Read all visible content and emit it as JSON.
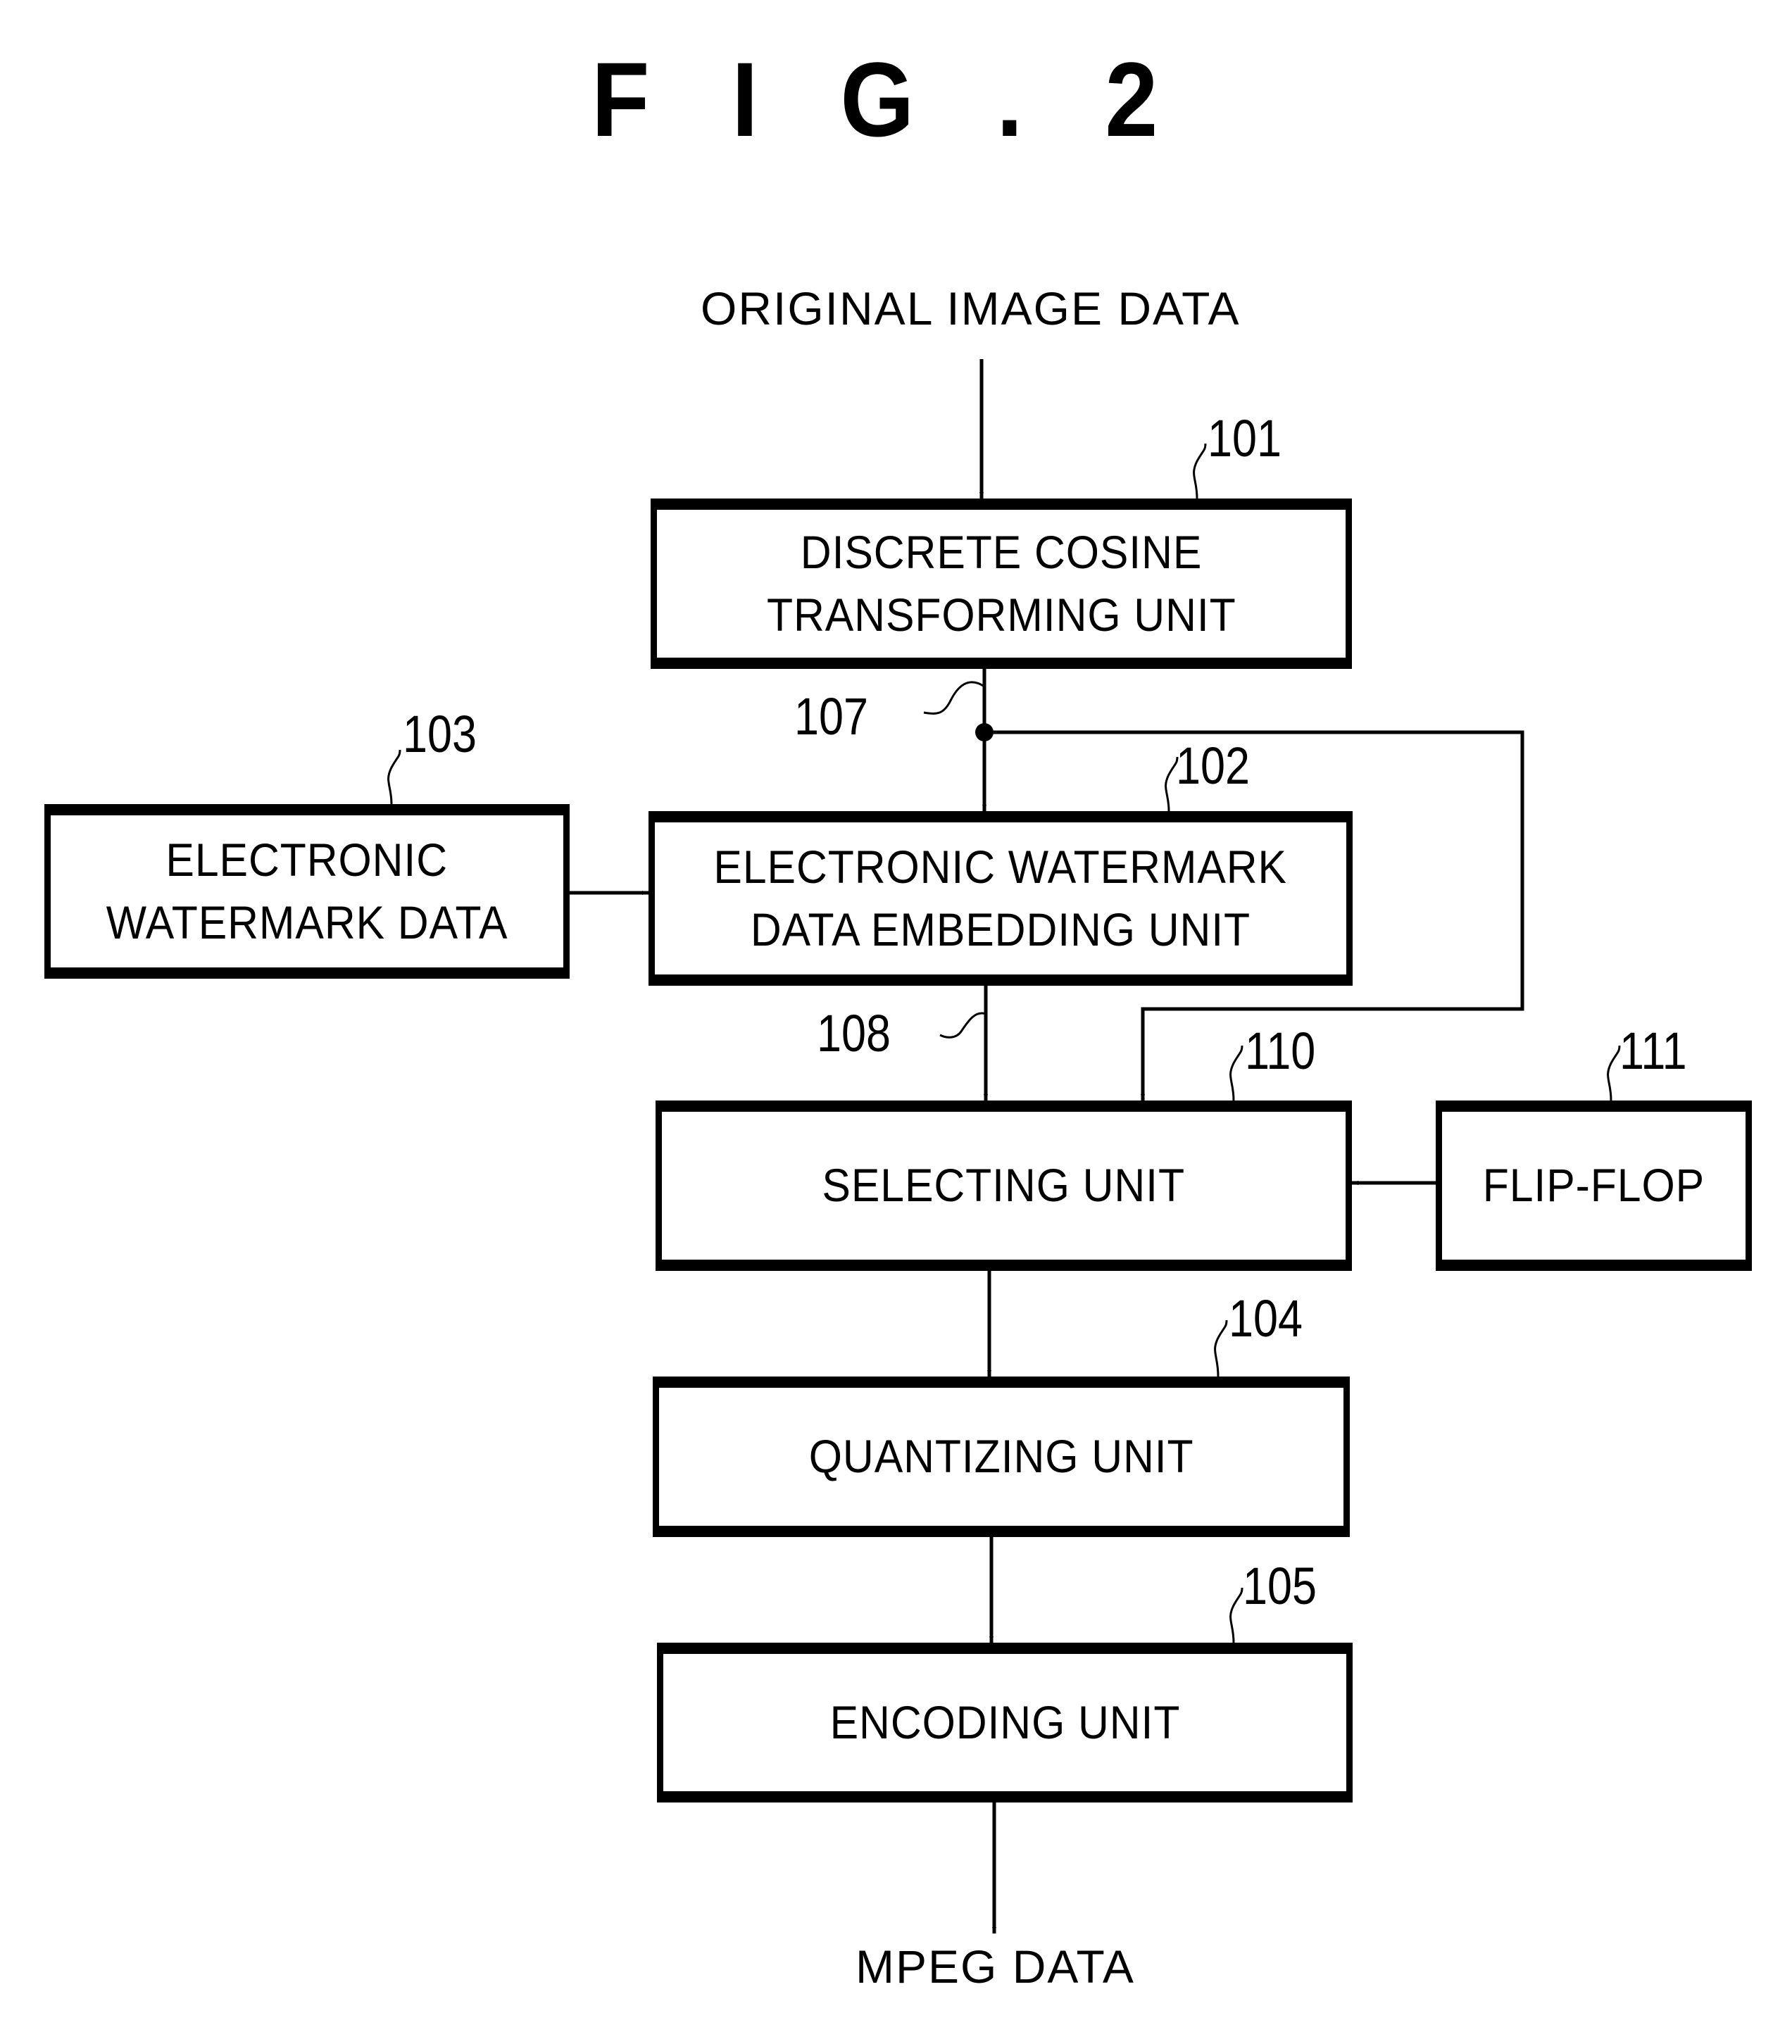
{
  "figure": {
    "title": "F I G . 2"
  },
  "inputs": {
    "original": "ORIGINAL IMAGE DATA",
    "output": "MPEG DATA"
  },
  "blocks": [
    {
      "ref": "101",
      "lines": [
        "DISCRETE COSINE",
        "TRANSFORMING UNIT"
      ]
    },
    {
      "ref": "102",
      "lines": [
        "ELECTRONIC WATERMARK",
        "DATA EMBEDDING UNIT"
      ]
    },
    {
      "ref": "103",
      "lines": [
        "ELECTRONIC",
        "WATERMARK DATA"
      ]
    },
    {
      "ref": "110",
      "lines": [
        "SELECTING UNIT"
      ]
    },
    {
      "ref": "111",
      "lines": [
        "FLIP-FLOP"
      ]
    },
    {
      "ref": "104",
      "lines": [
        "QUANTIZING UNIT"
      ]
    },
    {
      "ref": "105",
      "lines": [
        "ENCODING UNIT"
      ]
    }
  ],
  "signals": [
    {
      "ref": "107"
    },
    {
      "ref": "108"
    }
  ]
}
